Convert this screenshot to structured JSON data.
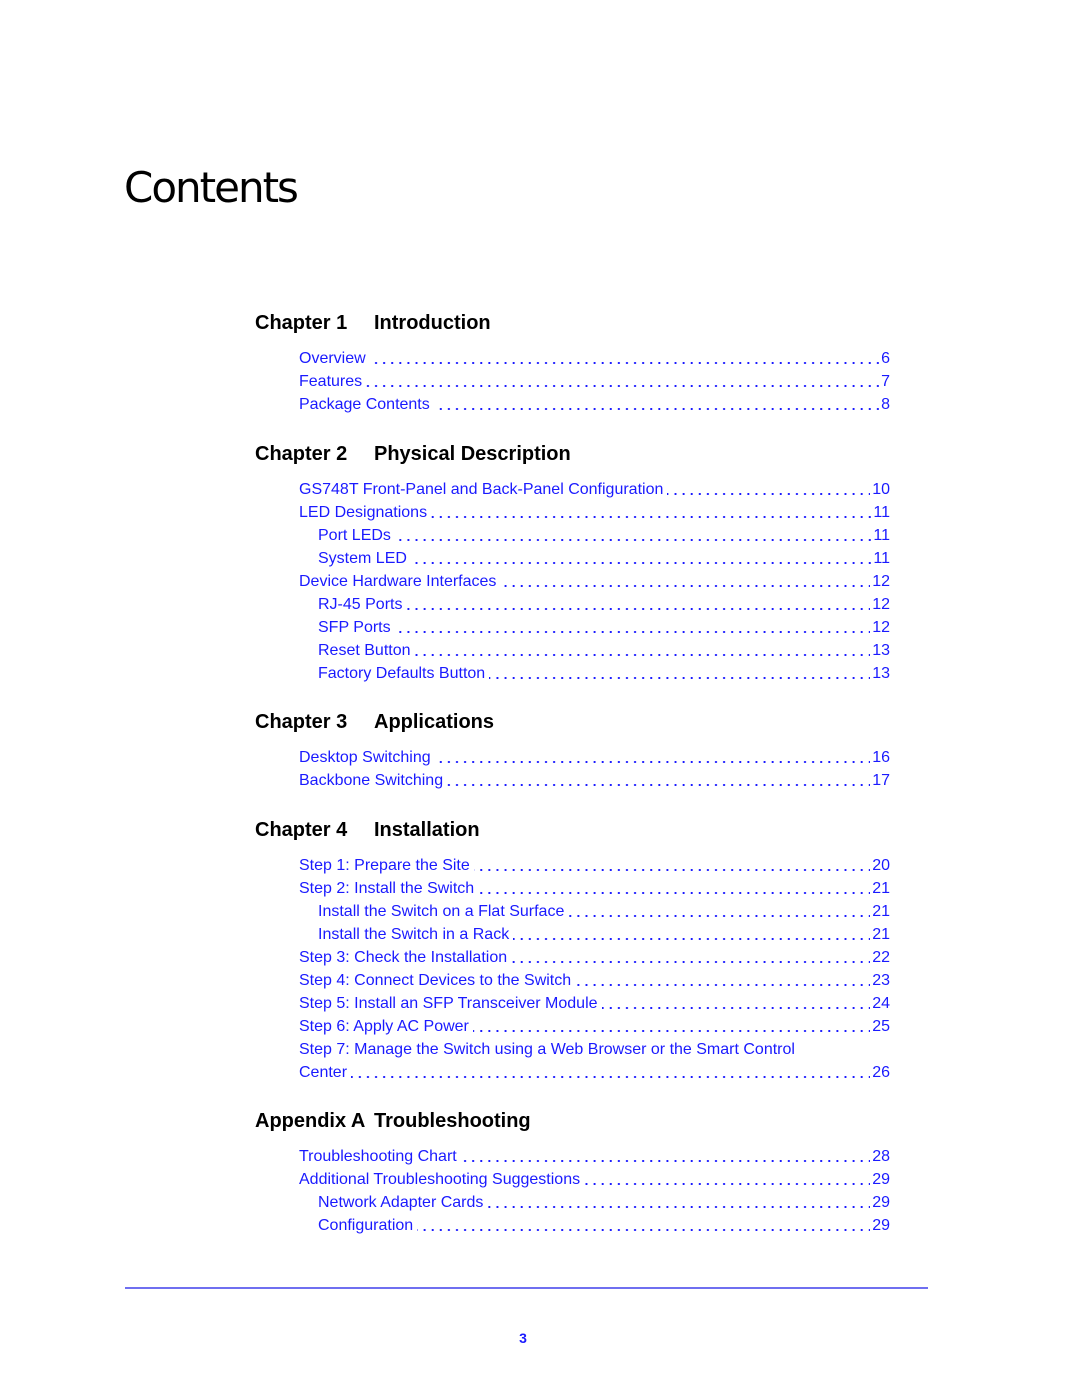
{
  "title": "Contents",
  "sections": [
    {
      "label": "Chapter 1",
      "title": "Introduction",
      "entries": [
        {
          "text": "Overview",
          "page": "6",
          "level": 1
        },
        {
          "text": "Features",
          "page": "7",
          "level": 1
        },
        {
          "text": "Package Contents",
          "page": "8",
          "level": 1
        }
      ]
    },
    {
      "label": "Chapter 2",
      "title": "Physical Description",
      "entries": [
        {
          "text": "GS748T Front-Panel and Back-Panel Configuration",
          "page": "10",
          "level": 1
        },
        {
          "text": "LED Designations",
          "page": "11",
          "level": 1
        },
        {
          "text": "Port LEDs",
          "page": "11",
          "level": 2
        },
        {
          "text": "System LED",
          "page": "11",
          "level": 2
        },
        {
          "text": "Device Hardware Interfaces",
          "page": "12",
          "level": 1
        },
        {
          "text": "RJ-45 Ports",
          "page": "12",
          "level": 2
        },
        {
          "text": "SFP Ports",
          "page": "12",
          "level": 2
        },
        {
          "text": "Reset Button",
          "page": "13",
          "level": 2
        },
        {
          "text": "Factory Defaults Button",
          "page": "13",
          "level": 2
        }
      ]
    },
    {
      "label": "Chapter 3",
      "title": "Applications",
      "entries": [
        {
          "text": "Desktop Switching",
          "page": "16",
          "level": 1
        },
        {
          "text": "Backbone Switching",
          "page": "17",
          "level": 1
        }
      ]
    },
    {
      "label": "Chapter 4",
      "title": "Installation",
      "entries": [
        {
          "text": "Step 1: Prepare the Site",
          "page": "20",
          "level": 1
        },
        {
          "text": "Step 2: Install the Switch",
          "page": "21",
          "level": 1
        },
        {
          "text": "Install the Switch on a Flat Surface",
          "page": "21",
          "level": 2
        },
        {
          "text": "Install the Switch in a Rack",
          "page": "21",
          "level": 2
        },
        {
          "text": "Step 3: Check the Installation",
          "page": "22",
          "level": 1
        },
        {
          "text": "Step 4: Connect Devices to the Switch",
          "page": "23",
          "level": 1
        },
        {
          "text": "Step 5: Install an SFP Transceiver Module",
          "page": "24",
          "level": 1
        },
        {
          "text": "Step 6: Apply AC Power",
          "page": "25",
          "level": 1
        },
        {
          "text": "Step 7: Manage the Switch using a Web Browser or the Smart Control",
          "page": "",
          "level": 1,
          "wrap": true
        },
        {
          "text": "Center",
          "page": "26",
          "level": 1
        }
      ]
    },
    {
      "label": "Appendix A",
      "title": "Troubleshooting",
      "entries": [
        {
          "text": "Troubleshooting Chart",
          "page": "28",
          "level": 1
        },
        {
          "text": "Additional Troubleshooting Suggestions",
          "page": "29",
          "level": 1
        },
        {
          "text": "Network Adapter Cards",
          "page": "29",
          "level": 2
        },
        {
          "text": "Configuration",
          "page": "29",
          "level": 2
        }
      ]
    }
  ],
  "footer": {
    "page_number": "3"
  }
}
